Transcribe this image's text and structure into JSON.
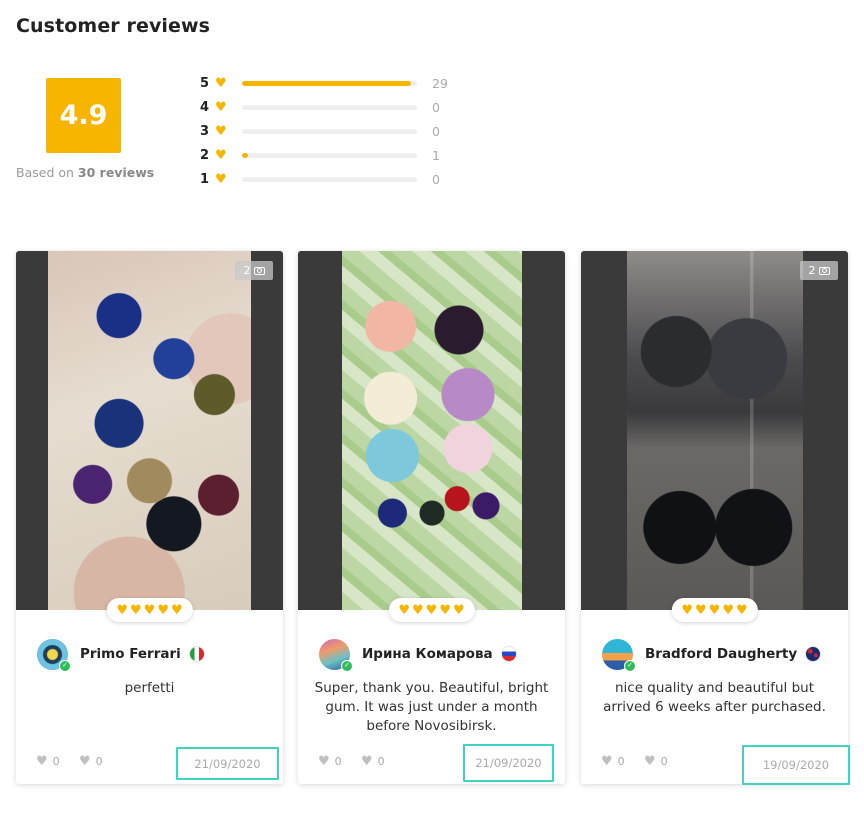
{
  "heading": "Customer reviews",
  "summary": {
    "score": "4.9",
    "based_prefix": "Based on",
    "based_count": "30 reviews"
  },
  "distribution": [
    {
      "stars": "5",
      "count": "29",
      "fraction": 0.967
    },
    {
      "stars": "4",
      "count": "0",
      "fraction": 0
    },
    {
      "stars": "3",
      "count": "0",
      "fraction": 0
    },
    {
      "stars": "2",
      "count": "1",
      "fraction": 0.033
    },
    {
      "stars": "1",
      "count": "0",
      "fraction": 0
    }
  ],
  "icons": {
    "rating": "heart-icon",
    "photo_count": "camera-icon",
    "verified": "check-badge-icon",
    "vote": "heart-outline-icon"
  },
  "colors": {
    "accent": "#f7b500",
    "verified": "#2ebd59",
    "highlight_box": "#3fd3c4"
  },
  "reviews": [
    {
      "photo_count": "2",
      "rating": 5,
      "author": "Primo Ferrari",
      "country": "Italy",
      "text": "perfetti",
      "likes": "0",
      "dislikes": "0",
      "date": "21/09/2020"
    },
    {
      "photo_count": "",
      "rating": 5,
      "author": "Ирина Комарова",
      "country": "Russia",
      "text": "Super, thank you. Beautiful, bright gum. It was just under a month before Novosibirsk.",
      "likes": "0",
      "dislikes": "0",
      "date": "21/09/2020"
    },
    {
      "photo_count": "2",
      "rating": 5,
      "author": "Bradford Daugherty",
      "country": "New Zealand",
      "text": "nice quality and beautiful but arrived 6 weeks after purchased.",
      "likes": "0",
      "dislikes": "0",
      "date": "19/09/2020"
    }
  ]
}
